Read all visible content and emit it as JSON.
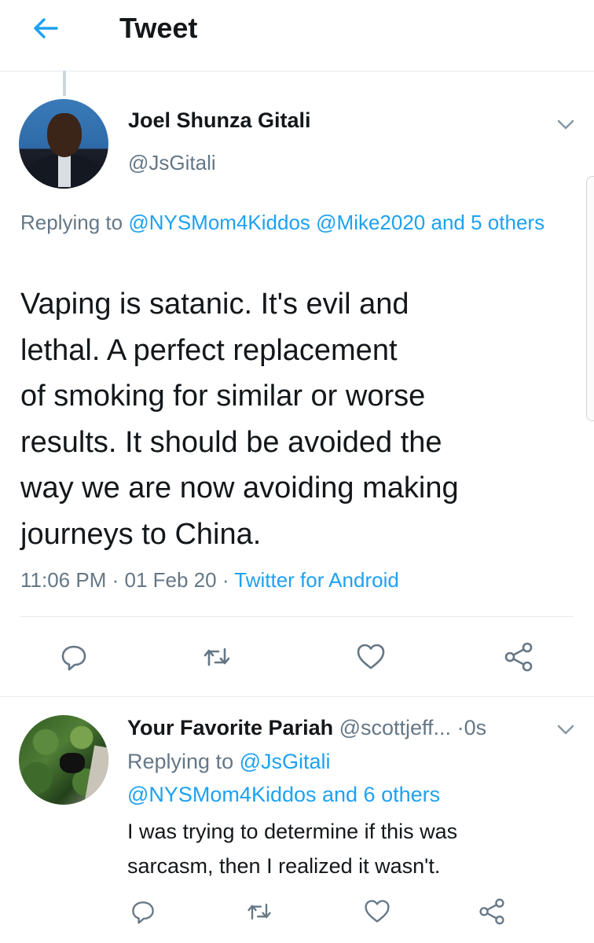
{
  "header": {
    "title": "Tweet",
    "back_icon": "arrow-left-icon"
  },
  "colors": {
    "accent": "#1da1f2",
    "secondary_text": "#657786",
    "primary_text": "#14171a",
    "divider": "#e6ecf0"
  },
  "tweet": {
    "author_name": "Joel Shunza Gitali",
    "author_handle": "@JsGitali",
    "replying_prefix": "Replying to ",
    "replying_mention_1": "@NYSMom4Kiddos",
    "replying_mention_2": "@Mike2020",
    "replying_others": "and 5 others",
    "text_lines": [
      "Vaping is satanic. It's evil and",
      "lethal. A perfect replacement",
      "of smoking for similar or worse",
      "results. It should be avoided the",
      "way we are now avoiding making",
      "journeys to China."
    ],
    "time": "11:06 PM",
    "date": "01 Feb 20",
    "separator": "·",
    "source": "Twitter for Android"
  },
  "reply": {
    "author_name": "Your Favorite Pariah",
    "author_handle": "@scottjeff...",
    "time_sep": "·",
    "time": "0s",
    "replying_prefix": "Replying to ",
    "replying_mention": "@JsGitali",
    "replying_line2": "@NYSMom4Kiddos and 6 others",
    "text_lines": [
      "I was trying to determine if this was",
      "sarcasm, then I realized it wasn't."
    ]
  },
  "actions": [
    "reply-icon",
    "retweet-icon",
    "like-icon",
    "share-icon"
  ]
}
